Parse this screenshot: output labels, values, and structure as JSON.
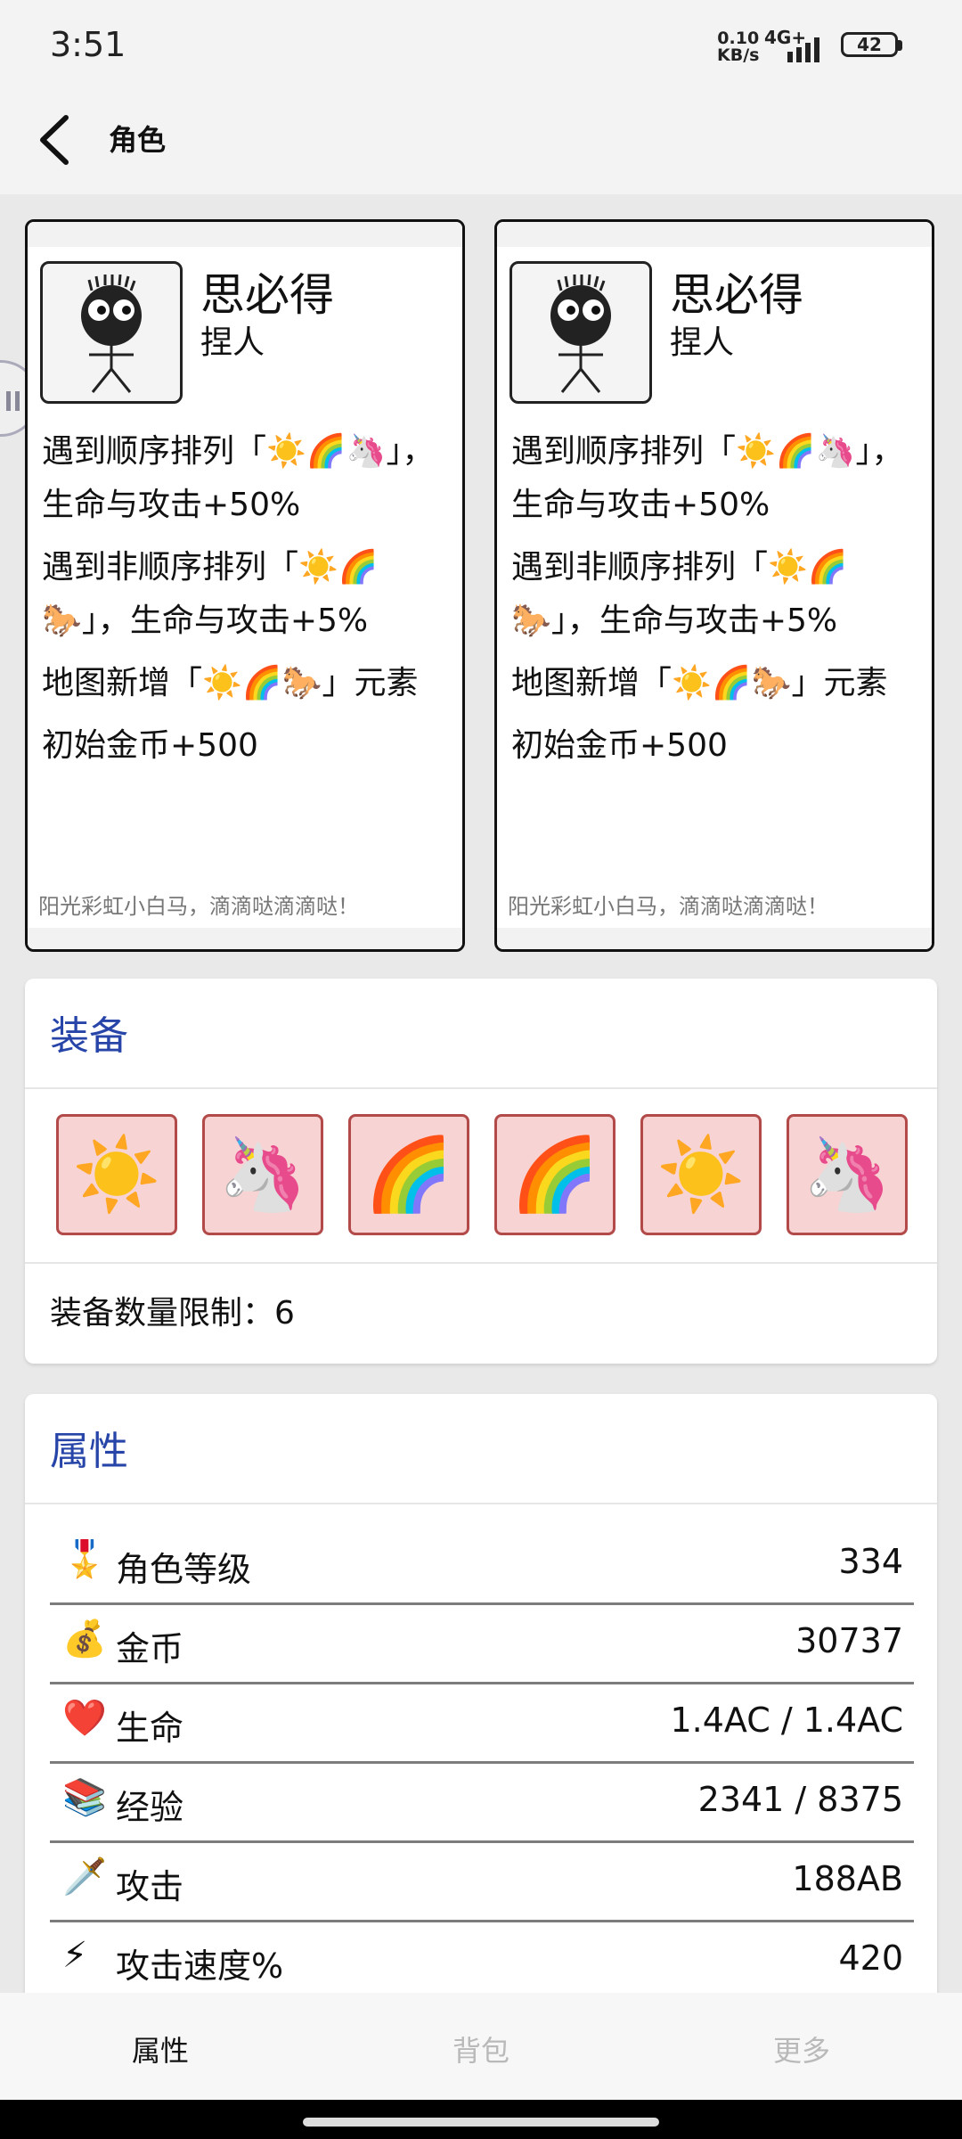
{
  "status_bar": {
    "time": "3:51",
    "net_speed_value": "0.10",
    "net_speed_unit": "KB/s",
    "network": "4G+",
    "battery": "42"
  },
  "app_bar": {
    "title": "角色",
    "back_icon": "back-arrow-icon"
  },
  "character_cards": [
    {
      "name": "思必得",
      "type": "捏人",
      "skills": [
        "遇到顺序排列「☀️🌈🦄」，生命与攻击+50%",
        "遇到非顺序排列「☀️🌈🐎」，生命与攻击+5%",
        "地图新增「☀️🌈🐎」元素",
        "初始金币+500"
      ],
      "quote": "阳光彩虹小白马，滴滴哒滴滴哒！"
    },
    {
      "name": "思必得",
      "type": "捏人",
      "skills": [
        "遇到顺序排列「☀️🌈🦄」，生命与攻击+50%",
        "遇到非顺序排列「☀️🌈🐎」，生命与攻击+5%",
        "地图新增「☀️🌈🐎」元素",
        "初始金币+500"
      ],
      "quote": "阳光彩虹小白马，滴滴哒滴滴哒！"
    }
  ],
  "equipment": {
    "title": "装备",
    "slots": [
      "☀️",
      "🦄",
      "🌈",
      "🌈",
      "☀️",
      "🦄"
    ],
    "limit_label": "装备数量限制：",
    "limit_value": "6"
  },
  "attributes": {
    "title": "属性",
    "rows": [
      {
        "icon": "🎖️",
        "label": "角色等级",
        "value": "334"
      },
      {
        "icon": "💰",
        "label": "金币",
        "value": "30737"
      },
      {
        "icon": "❤️",
        "label": "生命",
        "value": "1.4AC / 1.4AC"
      },
      {
        "icon": "📚",
        "label": "经验",
        "value": "2341 / 8375"
      },
      {
        "icon": "🗡️",
        "label": "攻击",
        "value": "188AB"
      },
      {
        "icon": "⚡",
        "label": "攻击速度%",
        "value": "420"
      }
    ]
  },
  "bottom_nav": {
    "items": [
      {
        "label": "属性",
        "active": true
      },
      {
        "label": "背包",
        "active": false
      },
      {
        "label": "更多",
        "active": false
      }
    ]
  },
  "colors": {
    "accent": "#2745a8",
    "slot_bg": "#f8d3d3",
    "slot_border": "#b24a4a",
    "nav_inactive": "#b9b9b9"
  }
}
